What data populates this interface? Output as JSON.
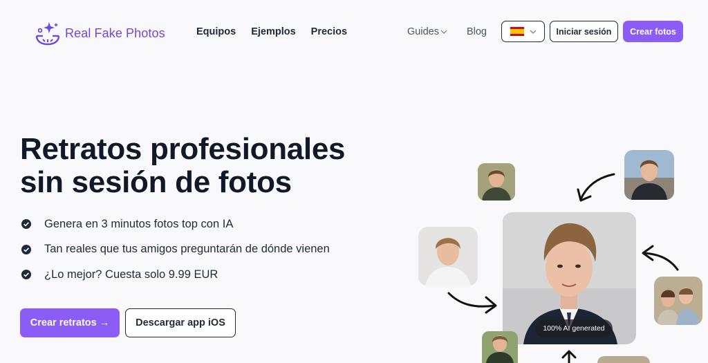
{
  "header": {
    "brand": "Real Fake Photos",
    "nav": [
      "Equipos",
      "Ejemplos",
      "Precios"
    ],
    "guides_label": "Guides",
    "blog_label": "Blog",
    "login_label": "Iniciar sesión",
    "create_label": "Crear fotos"
  },
  "hero": {
    "title_line1": "Retratos profesionales",
    "title_line2": "sin sesión de fotos",
    "features": [
      "Genera en 3 minutos fotos top con IA",
      "Tan reales que tus amigos preguntarán de dónde vienen",
      "¿Lo mejor? Cuesta solo 9.99 EUR"
    ],
    "primary_cta": "Crear retratos →",
    "secondary_cta": "Descargar app iOS"
  },
  "gallery": {
    "badge": "100% AI generated"
  },
  "colors": {
    "accent": "#8b5cf6",
    "brand_text": "#6d4ad6",
    "background": "#f9f9fc",
    "text": "#111827"
  },
  "icons": {
    "logo": "sparkle-face-logo-icon",
    "language": "spain-flag-icon",
    "dropdown": "chevron-down-icon",
    "feature": "check-circle-icon",
    "arrows": "curved-arrow-icon"
  }
}
